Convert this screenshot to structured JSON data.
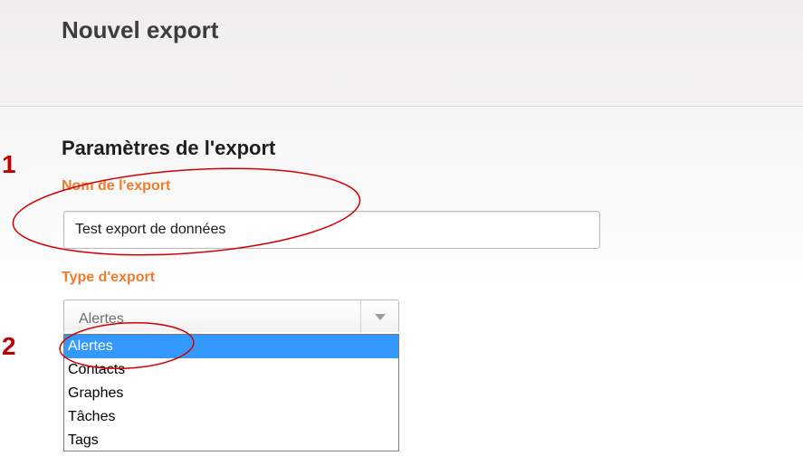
{
  "header": {
    "title": "Nouvel export"
  },
  "section": {
    "title": "Paramètres de l'export"
  },
  "export_name": {
    "label": "Nom de l'export",
    "value": "Test export de données"
  },
  "export_type": {
    "label": "Type d'export",
    "selected_value": "Alertes",
    "options": [
      "Alertes",
      "Contacts",
      "Graphes",
      "Tâches",
      "Tags"
    ],
    "highlighted_option": "Alertes"
  },
  "annotations": {
    "marker_1": "1",
    "marker_2": "2",
    "color": "#c00000"
  },
  "colors": {
    "label_accent": "#f07c2a",
    "selection_highlight": "#3399ff"
  },
  "icons": {
    "select_arrow": "chevron-down-icon"
  }
}
